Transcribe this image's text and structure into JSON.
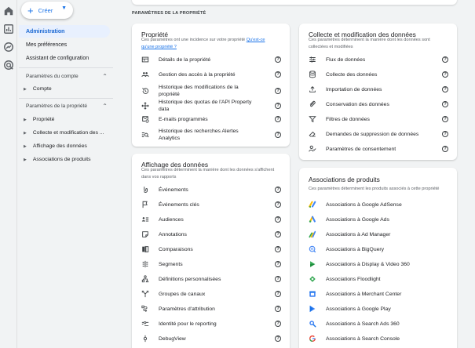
{
  "rail": {
    "icons": [
      "home-icon",
      "reports-icon",
      "explore-icon",
      "advertising-icon"
    ]
  },
  "nav": {
    "create_label": "Créer",
    "admin_label": "Administration",
    "prefs_label": "Mes préférences",
    "config_label": "Assistant de configuration",
    "account_section": "Paramètres du compte",
    "account_item": "Compte",
    "property_section": "Paramètres de la propriété",
    "property_items": [
      "Propriété",
      "Collecte et modification des ...",
      "Affichage des données",
      "Associations de produits"
    ]
  },
  "page": {
    "title": "PARAMÈTRES DE LA PROPRIÉTÉ"
  },
  "propriete": {
    "title": "Propriété",
    "desc": "Ces paramètres ont une incidence sur votre propriété",
    "link": "Qu'est-ce qu'une propriété ?",
    "items": [
      "Détails de la propriété",
      "Gestion des accès à la propriété",
      "Historique des modifications de la propriété",
      "Historique des quotas de l'API Property data",
      "E-mails programmés",
      "Historique des recherches Alertes Analytics"
    ]
  },
  "collecte": {
    "title": "Collecte et modification des données",
    "desc": "Ces paramètres déterminent la manière dont les données sont collectées et modifiées",
    "items": [
      "Flux de données",
      "Collecte des données",
      "Importation de données",
      "Conservation des données",
      "Filtres de données",
      "Demandes de suppression de données",
      "Paramètres de consentement"
    ]
  },
  "affichage": {
    "title": "Affichage des données",
    "desc": "Ces paramètres déterminent la manière dont les données s'affichent dans vos rapports",
    "items": [
      "Événements",
      "Événements clés",
      "Audiences",
      "Annotations",
      "Comparaisons",
      "Segments",
      "Définitions personnalisées",
      "Groupes de canaux",
      "Paramètres d'attribution",
      "Identité pour le reporting",
      "DebugView"
    ]
  },
  "associations": {
    "title": "Associations de produits",
    "desc": "Ces paramètres déterminent les produits associés à cette propriété",
    "items": [
      "Associations à Google AdSense",
      "Associations à Google Ads",
      "Associations à Ad Manager",
      "Associations à BigQuery",
      "Associations à Display & Video 360",
      "Associations Floodlight",
      "Associations à Merchant Center",
      "Associations à Google Play",
      "Associations à Search Ads 360",
      "Associations à Search Console"
    ]
  },
  "colors": {
    "accent": "#1a73e8",
    "active_bg": "#e8f0fe",
    "background": "#f1f3f4"
  }
}
